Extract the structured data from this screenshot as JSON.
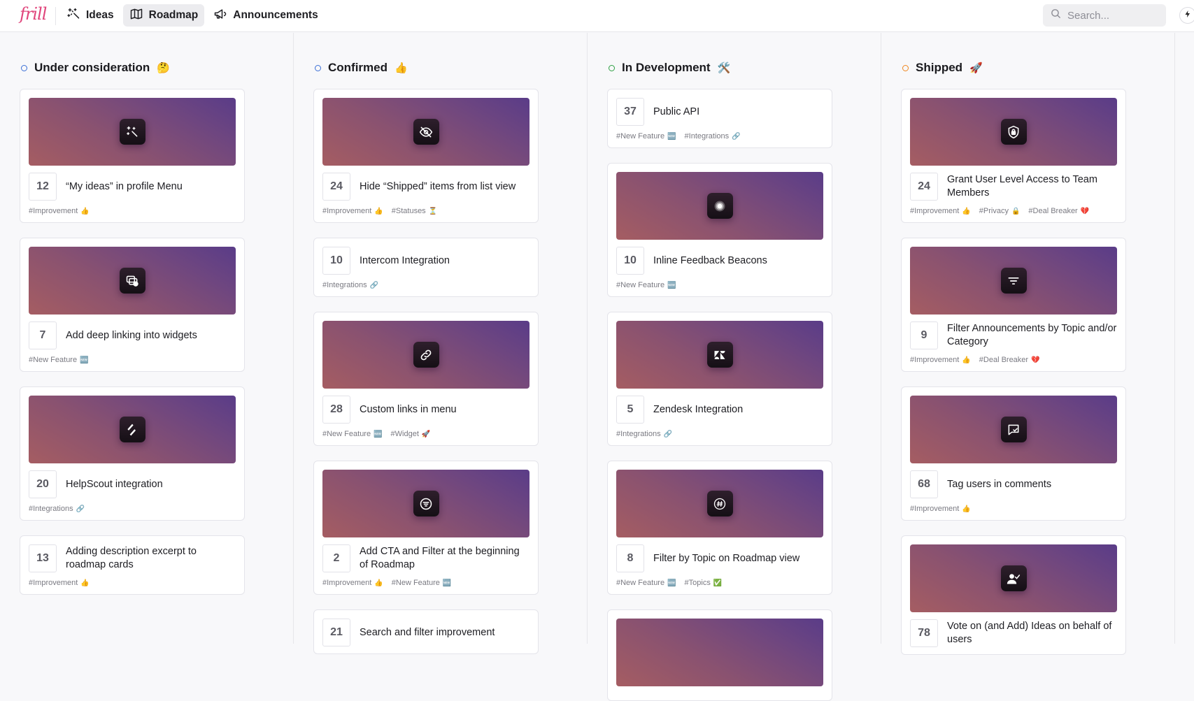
{
  "brand": {
    "logo_text": "frill"
  },
  "nav": [
    {
      "label": "Ideas",
      "icon": "magic-wand-icon",
      "active": false
    },
    {
      "label": "Roadmap",
      "icon": "map-icon",
      "active": true
    },
    {
      "label": "Announcements",
      "icon": "megaphone-icon",
      "active": false
    }
  ],
  "search": {
    "placeholder": "Search...",
    "value": ""
  },
  "colors": {
    "accent": "#e0457b",
    "under_consideration": "#3b6fd6",
    "confirmed": "#3b6fd6",
    "in_development": "#2ea043",
    "shipped": "#f0871f"
  },
  "columns": [
    {
      "title": "Under consideration",
      "emoji": "🤔",
      "status_color": "#3b6fd6",
      "cards": [
        {
          "votes": "12",
          "title": "“My ideas” in profile Menu",
          "icon": "magic-wand-icon",
          "tags": [
            {
              "label": "#Improvement",
              "emoji": "👍"
            }
          ]
        },
        {
          "votes": "7",
          "title": "Add deep linking into widgets",
          "icon": "deep-link-icon",
          "tags": [
            {
              "label": "#New Feature",
              "emoji": "🆕"
            }
          ]
        },
        {
          "votes": "20",
          "title": "HelpScout integration",
          "icon": "helpscout-icon",
          "tags": [
            {
              "label": "#Integrations",
              "emoji": "🔗"
            }
          ]
        },
        {
          "votes": "13",
          "title": "Adding description excerpt to roadmap cards",
          "icon": null,
          "tags": [
            {
              "label": "#Improvement",
              "emoji": "👍"
            }
          ]
        }
      ]
    },
    {
      "title": "Confirmed",
      "emoji": "👍",
      "status_color": "#3b6fd6",
      "cards": [
        {
          "votes": "24",
          "title": "Hide “Shipped” items from list view",
          "icon": "eye-off-icon",
          "tags": [
            {
              "label": "#Improvement",
              "emoji": "👍"
            },
            {
              "label": "#Statuses",
              "emoji": "⏳"
            }
          ]
        },
        {
          "votes": "10",
          "title": "Intercom Integration",
          "icon": null,
          "tags": [
            {
              "label": "#Integrations",
              "emoji": "🔗"
            }
          ]
        },
        {
          "votes": "28",
          "title": "Custom links in menu",
          "icon": "link-icon",
          "tags": [
            {
              "label": "#New Feature",
              "emoji": "🆕"
            },
            {
              "label": "#Widget",
              "emoji": "🚀"
            }
          ]
        },
        {
          "votes": "2",
          "title": "Add CTA and Filter at the beginning of Roadmap",
          "icon": "filter-circle-icon",
          "tags": [
            {
              "label": "#Improvement",
              "emoji": "👍"
            },
            {
              "label": "#New Feature",
              "emoji": "🆕"
            }
          ]
        },
        {
          "votes": "21",
          "title": "Search and filter improvement",
          "icon": null,
          "tags": []
        }
      ]
    },
    {
      "title": "In Development",
      "emoji": "🛠️",
      "status_color": "#2ea043",
      "cards": [
        {
          "votes": "37",
          "title": "Public API",
          "icon": null,
          "tags": [
            {
              "label": "#New Feature",
              "emoji": "🆕"
            },
            {
              "label": "#Integrations",
              "emoji": "🔗"
            }
          ]
        },
        {
          "votes": "10",
          "title": "Inline Feedback Beacons",
          "icon": "beacon-icon",
          "tags": [
            {
              "label": "#New Feature",
              "emoji": "🆕"
            }
          ]
        },
        {
          "votes": "5",
          "title": "Zendesk Integration",
          "icon": "zendesk-icon",
          "tags": [
            {
              "label": "#Integrations",
              "emoji": "🔗"
            }
          ]
        },
        {
          "votes": "8",
          "title": "Filter by Topic on Roadmap view",
          "icon": "hash-circle-icon",
          "tags": [
            {
              "label": "#New Feature",
              "emoji": "🆕"
            },
            {
              "label": "#Topics",
              "emoji": "✅"
            }
          ]
        },
        {
          "votes": "",
          "title": "",
          "icon": "blank-cover",
          "tags": []
        }
      ]
    },
    {
      "title": "Shipped",
      "emoji": "🚀",
      "status_color": "#f0871f",
      "cards": [
        {
          "votes": "24",
          "title": "Grant User Level Access to Team Members",
          "icon": "shield-lock-icon",
          "tags": [
            {
              "label": "#Improvement",
              "emoji": "👍"
            },
            {
              "label": "#Privacy",
              "emoji": "🔒"
            },
            {
              "label": "#Deal Breaker",
              "emoji": "💔"
            }
          ]
        },
        {
          "votes": "9",
          "title": "Filter Announcements by Topic and/or Category",
          "icon": "filter-lines-icon",
          "tags": [
            {
              "label": "#Improvement",
              "emoji": "👍"
            },
            {
              "label": "#Deal Breaker",
              "emoji": "💔"
            }
          ]
        },
        {
          "votes": "68",
          "title": "Tag users in comments",
          "icon": "message-check-icon",
          "tags": [
            {
              "label": "#Improvement",
              "emoji": "👍"
            }
          ]
        },
        {
          "votes": "78",
          "title": "Vote on (and Add) Ideas on behalf of users",
          "icon": "user-check-icon",
          "tags": []
        }
      ]
    }
  ]
}
